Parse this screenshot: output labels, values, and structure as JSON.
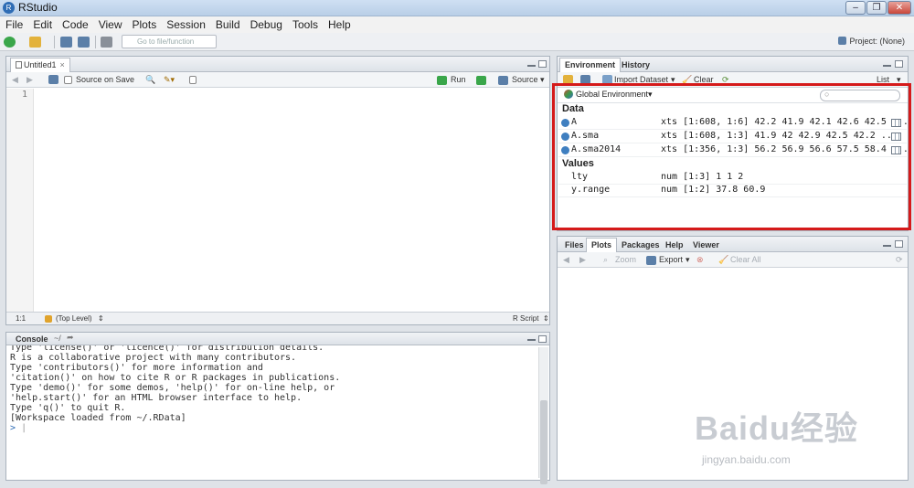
{
  "window": {
    "title": "RStudio",
    "controls": [
      "–",
      "❐",
      "✕"
    ]
  },
  "menu": [
    "File",
    "Edit",
    "Code",
    "View",
    "Plots",
    "Session",
    "Build",
    "Debug",
    "Tools",
    "Help"
  ],
  "toolbar": {
    "goto_placeholder": "Go to file/function",
    "project_label": "Project: (None)"
  },
  "editor": {
    "tab_label": "Untitled1",
    "source_on_save": "Source on Save",
    "run_label": "Run",
    "source_label": "Source",
    "line_number": "1",
    "status_pos": "1:1",
    "status_scope": "(Top Level)",
    "status_type": "R Script"
  },
  "console": {
    "tab_label": "Console",
    "path": "~/",
    "lines": [
      "Type 'license()' or 'licence()' for distribution details.",
      "",
      "R is a collaborative project with many contributors.",
      "Type 'contributors()' for more information and",
      "'citation()' on how to cite R or R packages in publications.",
      "",
      "Type 'demo()' for some demos, 'help()' for on-line help, or",
      "'help.start()' for an HTML browser interface to help.",
      "Type 'q()' to quit R.",
      "",
      "[Workspace loaded from ~/.RData]",
      ""
    ],
    "prompt": ">"
  },
  "environment": {
    "tabs": [
      "Environment",
      "History"
    ],
    "import_label": "Import Dataset",
    "clear_label": "Clear",
    "list_label": "List",
    "scope": "Global Environment",
    "data_header": "Data",
    "data": [
      {
        "name": "A",
        "value": "xts [1:608, 1:6] 42.2 41.9 42.1 42.6 42.5 ..."
      },
      {
        "name": "A.sma",
        "value": "xts [1:608, 1:3] 41.9 42 42.9 42.5 42.2 ..."
      },
      {
        "name": "A.sma2014",
        "value": "xts [1:356, 1:3] 56.2 56.9 56.6 57.5 58.4 ..."
      }
    ],
    "values_header": "Values",
    "values": [
      {
        "name": "lty",
        "value": "num [1:3] 1 1 2"
      },
      {
        "name": "y.range",
        "value": "num [1:2] 37.8 60.9"
      }
    ]
  },
  "files": {
    "tabs": [
      "Files",
      "Plots",
      "Packages",
      "Help",
      "Viewer"
    ],
    "zoom_label": "Zoom",
    "export_label": "Export",
    "clear_all_label": "Clear All"
  },
  "watermark": {
    "main": "Baidu经验",
    "sub": "jingyan.baidu.com"
  },
  "colors": {
    "accent": "#2f6db5",
    "highlight": "#d51a1a"
  }
}
